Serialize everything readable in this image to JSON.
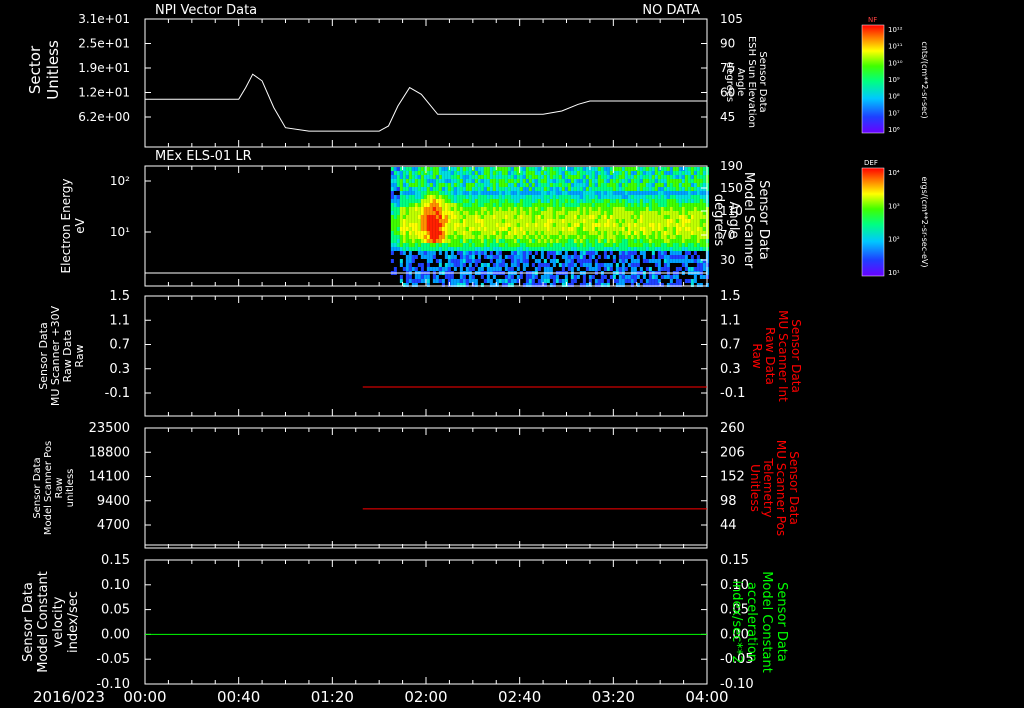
{
  "date_label": "2016/023",
  "time_ticks": [
    "00:00",
    "00:40",
    "01:20",
    "02:00",
    "02:40",
    "03:20",
    "04:00"
  ],
  "colors": {
    "white": "#ffffff",
    "red": "#ff0000",
    "green": "#00ff00",
    "bg": "#000000"
  },
  "panels": [
    {
      "id": "p1",
      "title_left": "NPI Vector Data",
      "title_right": "NO DATA",
      "left_label": [
        "Sector",
        "Unitless"
      ],
      "right_label": [
        "Sensor Data",
        "ESH Sun Elevation",
        "Angle",
        "degrees"
      ],
      "left_ticks": [
        "3.1e+01",
        "2.5e+01",
        "1.9e+01",
        "1.2e+01",
        "6.2e+00"
      ],
      "right_ticks": [
        "105",
        "90",
        "75",
        "60",
        "45"
      ]
    },
    {
      "id": "p2",
      "title_left": "MEx ELS-01 LR",
      "left_label": [
        "Electron Energy",
        "eV"
      ],
      "right_label": [
        "Sensor Data",
        "Model Scanner",
        "Angle",
        "degrees"
      ],
      "left_ticks": [
        "10²",
        "10¹"
      ],
      "right_ticks": [
        "190",
        "150",
        "110",
        "70",
        "30"
      ]
    },
    {
      "id": "p3",
      "left_label": [
        "Sensor Data",
        "MU Scanner +30V",
        "Raw Data",
        "Raw"
      ],
      "right_label": [
        "Sensor Data",
        "MU Scanner Int",
        "Raw Data",
        "Raw"
      ],
      "left_ticks": [
        "1.5",
        "1.1",
        "0.7",
        "0.3",
        "-0.1"
      ],
      "right_ticks": [
        "1.5",
        "1.1",
        "0.7",
        "0.3",
        "-0.1"
      ]
    },
    {
      "id": "p4",
      "left_label": [
        "Sensor Data",
        "Model Scanner Pos",
        "Raw",
        "unitless"
      ],
      "right_label": [
        "Sensor Data",
        "MU Scanner Pos",
        "Telemetry",
        "Unitless"
      ],
      "left_ticks": [
        "23500",
        "18800",
        "14100",
        "9400",
        "4700"
      ],
      "right_ticks": [
        "260",
        "206",
        "152",
        "98",
        "44"
      ]
    },
    {
      "id": "p5",
      "left_label": [
        "Sensor Data",
        "Model Constant",
        "velocity",
        "index/sec"
      ],
      "right_label": [
        "Sensor Data",
        "Model Constant",
        "acceleration",
        "index/sec**2"
      ],
      "left_ticks": [
        "0.15",
        "0.10",
        "0.05",
        "0.00",
        "-0.05",
        "-0.10"
      ],
      "right_ticks": [
        "0.15",
        "0.10",
        "0.05",
        "0.00",
        "-0.05",
        "-0.10"
      ]
    }
  ],
  "colorbars": [
    {
      "id": "cb1",
      "label": "NF",
      "unit": "cnts/(cm**2-sr-sec)",
      "ticks": [
        "10¹²",
        "10¹¹",
        "10¹⁰",
        "10⁹",
        "10⁸",
        "10⁷",
        "10⁶"
      ]
    },
    {
      "id": "cb2",
      "label": "DEF",
      "unit": "ergs/(cm**2-sr-sec-eV)",
      "ticks": [
        "10⁴",
        "10³",
        "10²",
        "10¹"
      ]
    }
  ],
  "chart_data": [
    {
      "type": "line",
      "panel": "p1",
      "ylabel": "Sector Unitless",
      "y2label": "ESH Sun Elevation Angle degrees",
      "y2lim": [
        30,
        105
      ],
      "series": [
        {
          "name": "ESH Sun Elevation Angle",
          "x": [
            0,
            20,
            35,
            40,
            43,
            46,
            50,
            55,
            60,
            70,
            85,
            95,
            100,
            104,
            108,
            113,
            118,
            125,
            140,
            160,
            170,
            178,
            185,
            190,
            200,
            210,
            220,
            240
          ],
          "y": [
            57,
            57,
            57,
            57,
            64,
            72,
            68,
            52,
            40,
            38,
            38,
            38,
            38,
            41,
            53,
            64,
            60,
            48,
            48,
            48,
            48,
            50,
            54,
            56,
            56,
            56,
            56,
            56
          ]
        }
      ]
    },
    {
      "type": "heatmap",
      "panel": "p2",
      "ylabel": "Electron Energy eV",
      "xrange_with_data": [
        105,
        240
      ],
      "note_series": [
        {
          "name": "Model Scanner Angle",
          "value": 20
        }
      ]
    },
    {
      "type": "line",
      "panel": "p3",
      "ylabel": "MU Scanner +30V Raw Data Raw",
      "y2label": "MU Scanner Int Raw Data Raw",
      "ylim": [
        -0.3,
        1.5
      ],
      "series": [
        {
          "name": "MU Scanner Int Raw Data",
          "x": [
            93,
            240
          ],
          "y": [
            0.05,
            0.05
          ]
        }
      ]
    },
    {
      "type": "line",
      "panel": "p4",
      "ylabel": "Model Scanner Pos Raw unitless",
      "y2label": "MU Scanner Pos Telemetry Unitless",
      "y2lim": [
        -2,
        260
      ],
      "series": [
        {
          "name": "MU Scanner Pos Telemetry",
          "x": [
            93,
            240
          ],
          "y": [
            80,
            80
          ]
        }
      ]
    },
    {
      "type": "line",
      "panel": "p5",
      "ylabel": "Model Constant velocity index/sec",
      "y2label": "Model Constant acceleration index/sec**2",
      "ylim": [
        -0.1,
        0.15
      ],
      "series": [
        {
          "name": "Model Constant acceleration",
          "x": [
            0,
            240
          ],
          "y": [
            0.0,
            0.0
          ]
        }
      ]
    }
  ]
}
